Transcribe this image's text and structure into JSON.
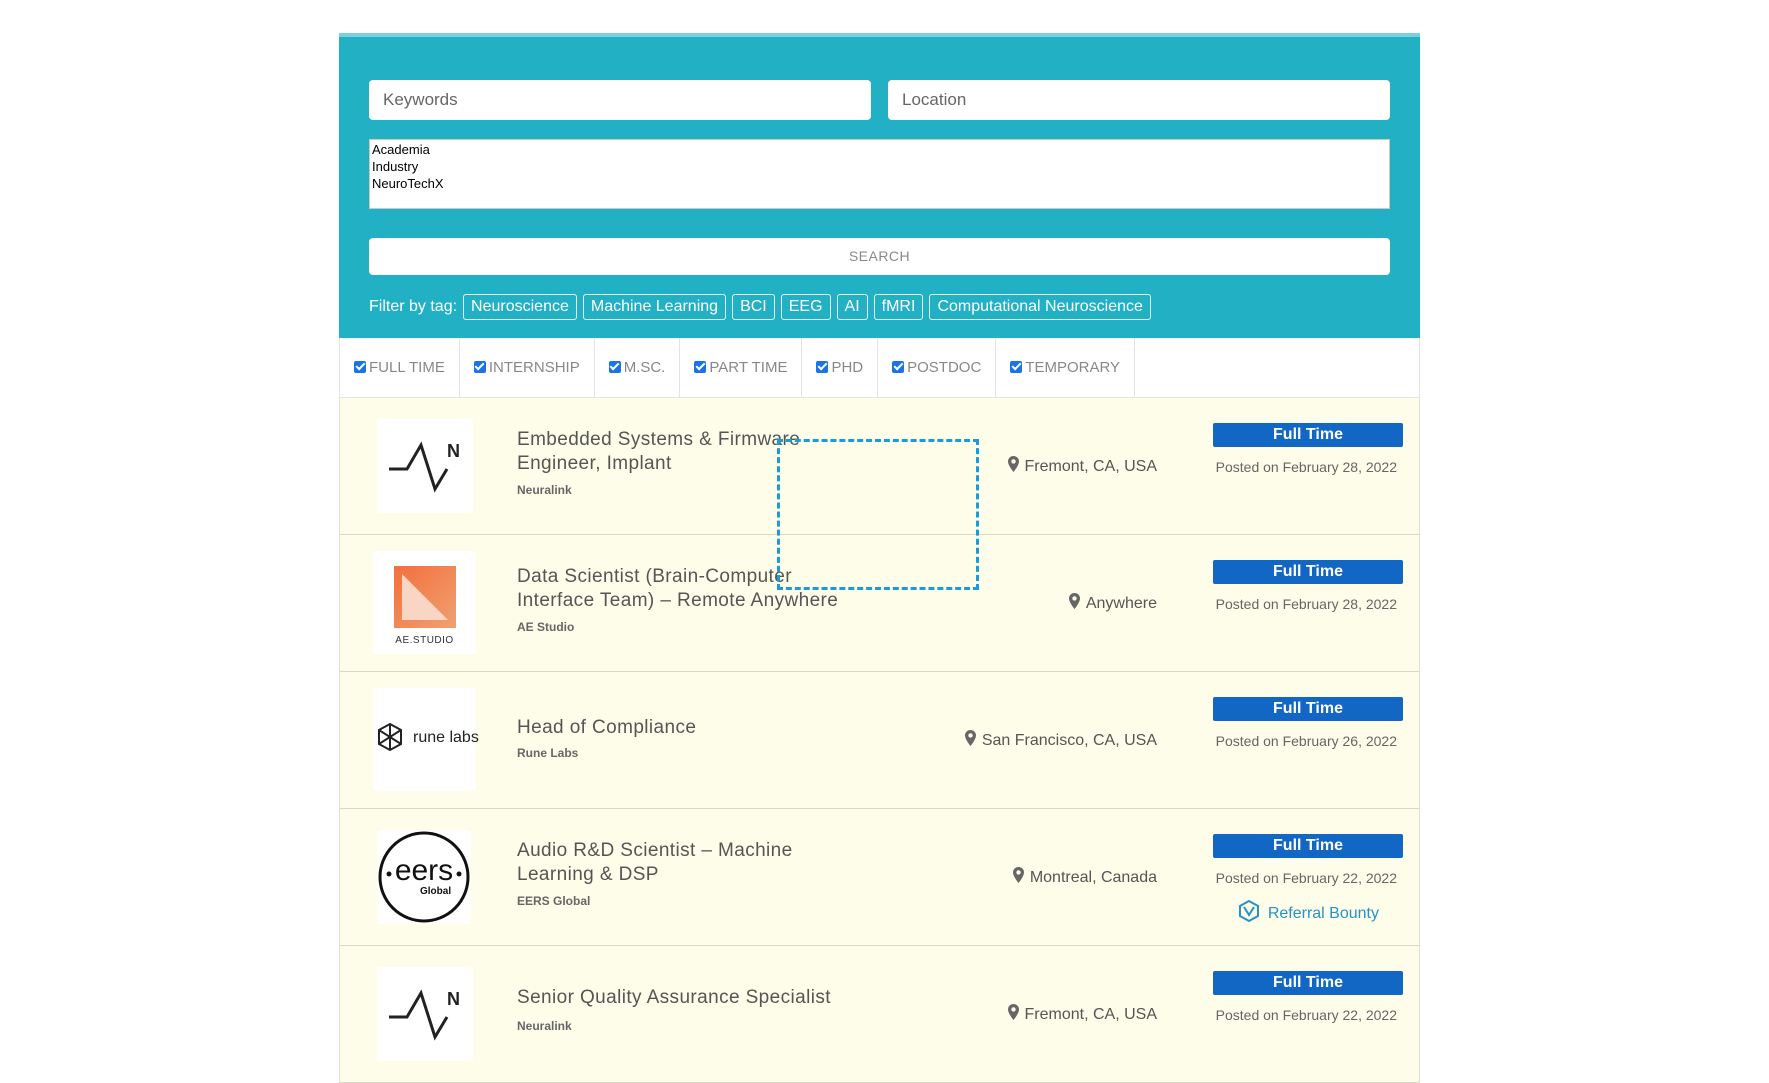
{
  "search": {
    "keywords_placeholder": "Keywords",
    "location_placeholder": "Location",
    "categories": [
      "Academia",
      "Industry",
      "NeuroTechX"
    ],
    "search_label": "SEARCH",
    "filter_label": "Filter by tag:",
    "tags": [
      "Neuroscience",
      "Machine Learning",
      "BCI",
      "EEG",
      "AI",
      "fMRI",
      "Computational Neuroscience"
    ]
  },
  "job_types": [
    "FULL TIME",
    "INTERNSHIP",
    "M.SC.",
    "PART TIME",
    "PHD",
    "POSTDOC",
    "TEMPORARY"
  ],
  "jobs": [
    {
      "title": "Embedded Systems & Firmware Engineer, Implant",
      "company": "Neuralink",
      "location": "Fremont, CA, USA",
      "type": "Full Time",
      "posted": "Posted on February 28, 2022",
      "logo": "neuralink-logo"
    },
    {
      "title": "Data Scientist (Brain-Computer Interface Team) – Remote Anywhere",
      "company": "AE Studio",
      "location": "Anywhere",
      "type": "Full Time",
      "posted": "Posted on February 28, 2022",
      "logo": "ae-studio-logo",
      "logo_text": "AE.STUDIO"
    },
    {
      "title": "Head of Compliance",
      "company": "Rune Labs",
      "location": "San Francisco, CA, USA",
      "type": "Full Time",
      "posted": "Posted on February 26, 2022",
      "logo": "rune-labs-logo",
      "logo_text": "rune labs"
    },
    {
      "title": "Audio R&D Scientist – Machine Learning & DSP",
      "company": "EERS Global",
      "location": "Montreal, Canada",
      "type": "Full Time",
      "posted": "Posted on February 22, 2022",
      "logo": "eers-global-logo",
      "logo_text": "eers",
      "logo_subtext": "Global",
      "bounty": "Referral Bounty"
    },
    {
      "title": "Senior Quality Assurance Specialist",
      "company": "Neuralink",
      "location": "Fremont, CA, USA",
      "type": "Full Time",
      "posted": "Posted on February 22, 2022",
      "logo": "neuralink-logo"
    }
  ],
  "colors": {
    "panel": "#22b0c5",
    "badge": "#1266c4",
    "row_bg": "#fdfde9",
    "bounty": "#2593c7"
  }
}
